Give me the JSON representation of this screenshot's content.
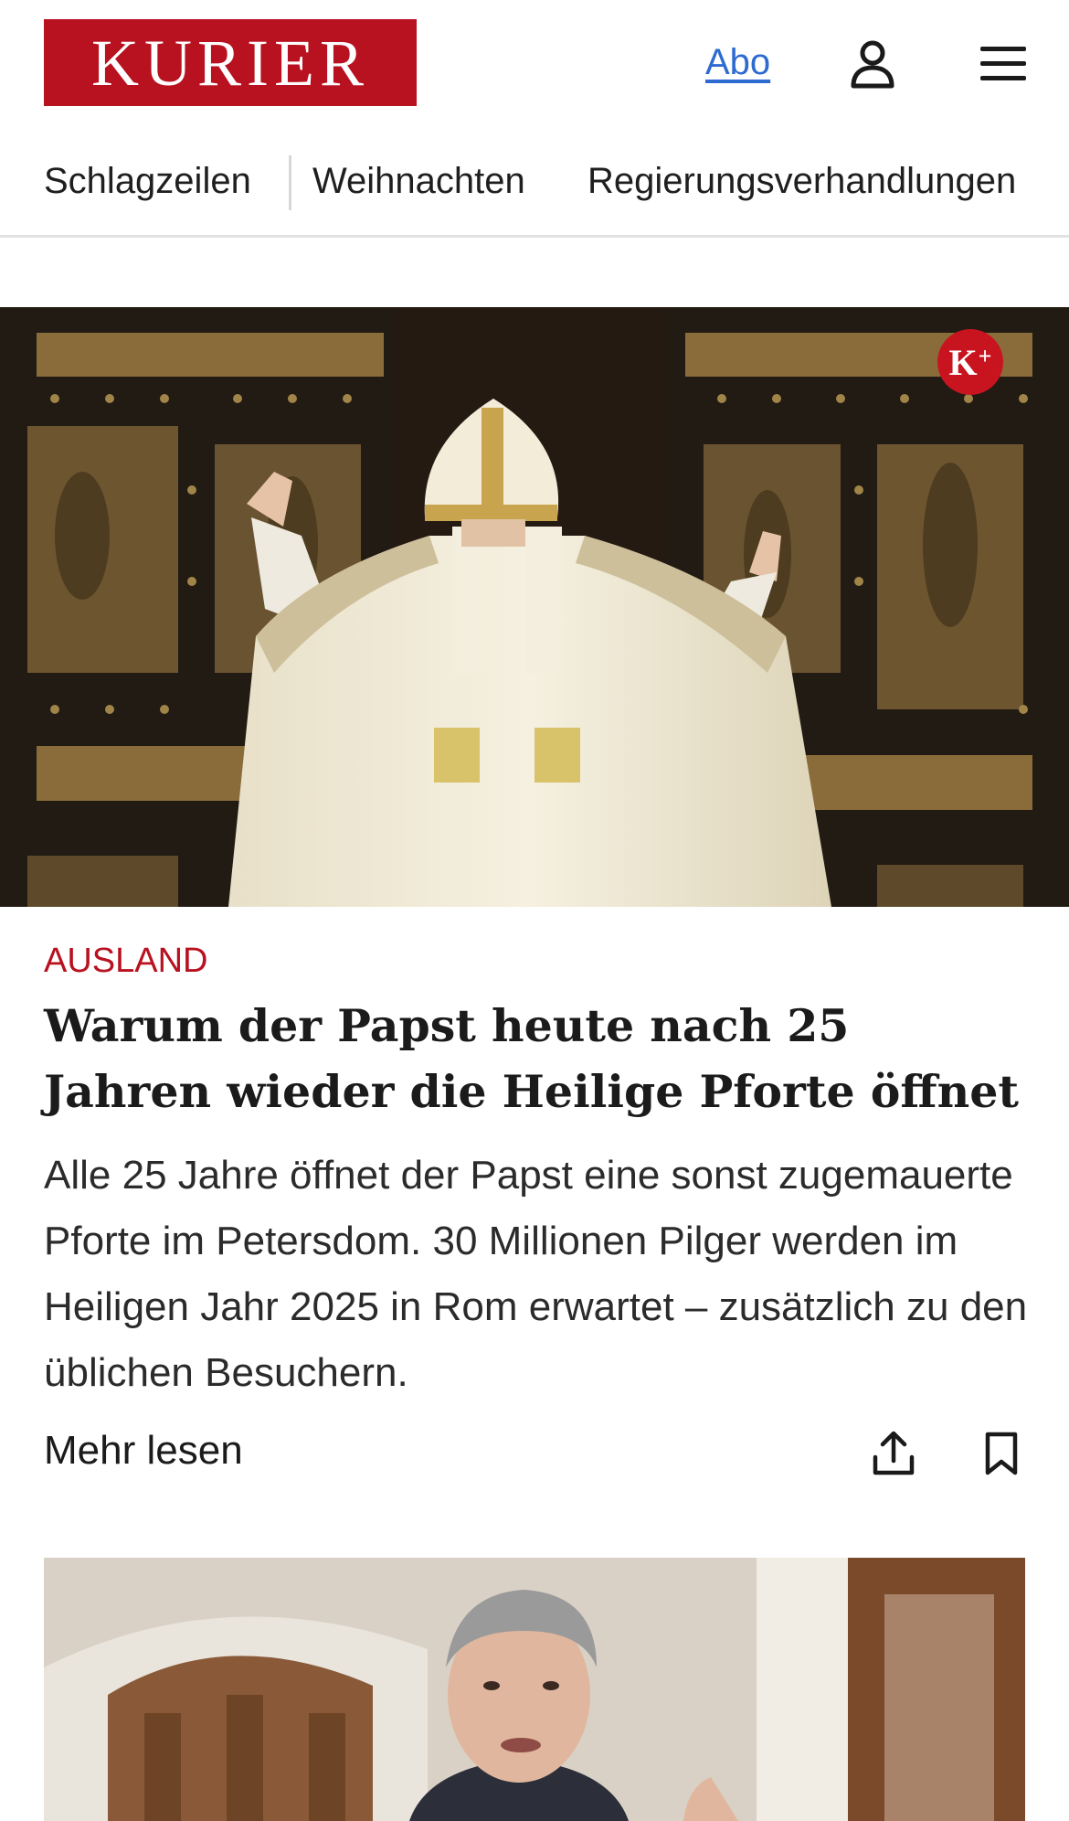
{
  "header": {
    "logo_text": "KURIER",
    "abo_label": "Abo",
    "user_icon": "user-icon",
    "menu_icon": "hamburger-menu-icon",
    "brand_color": "#b8111f",
    "link_color": "#2e6bd1"
  },
  "nav": {
    "items": [
      "Schlagzeilen",
      "Weihnachten",
      "Regierungsverhandlungen"
    ]
  },
  "article": {
    "premium_badge": "K",
    "premium_badge_plus": "+",
    "category": "AUSLAND",
    "headline": "Warum der Papst heute nach 25 Jahren wieder die Heilige Pforte öffnet",
    "teaser": "Alle 25 Jahre öffnet der Papst eine sonst zugemauerte Pforte im Petersdom. 30 Millionen Pilger werden im Heiligen Jahr 2025 in Rom erwartet – zusätzlich zu den üblichen Besuchern.",
    "more_label": "Mehr lesen",
    "share_icon": "share-icon",
    "bookmark_icon": "bookmark-icon"
  }
}
